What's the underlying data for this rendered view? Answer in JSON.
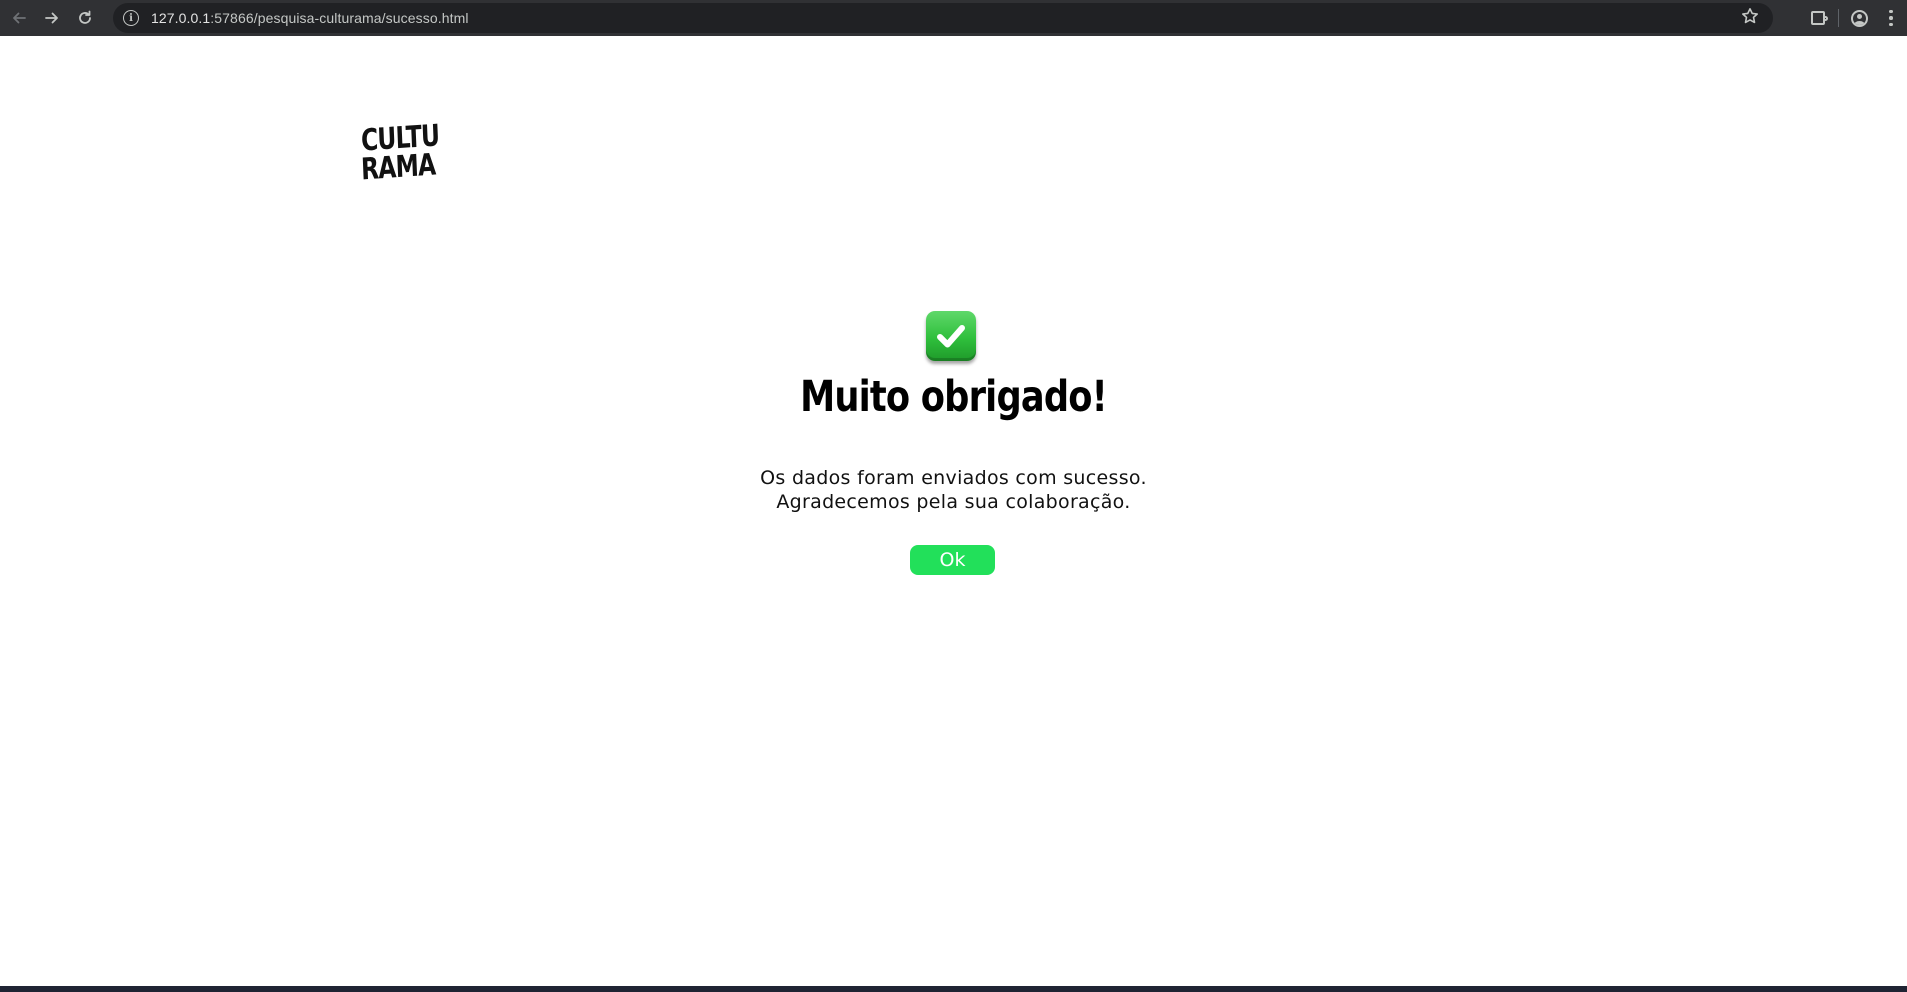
{
  "browser": {
    "url_host": "127.0.0.1",
    "url_path": ":57866/pesquisa-culturama/sucesso.html",
    "back_icon": "arrow-left-icon",
    "forward_icon": "arrow-right-icon",
    "reload_icon": "reload-icon",
    "info_icon": "info-icon",
    "bookmark_icon": "star-icon",
    "extensions_icon": "puzzle-icon",
    "profile_icon": "profile-icon",
    "menu_icon": "kebab-menu-icon"
  },
  "logo": {
    "line1": "CULTU",
    "line2": "RAMA"
  },
  "success": {
    "icon": "check-mark-icon",
    "title": "Muito obrigado!",
    "message_line1": "Os dados foram enviados com sucesso.",
    "message_line2": "Agradecemos pela sua colaboração.",
    "button_label": "Ok"
  },
  "colors": {
    "button_green": "#22e05a",
    "check_green": "#2fbf3c",
    "browser_chrome": "#303134"
  }
}
